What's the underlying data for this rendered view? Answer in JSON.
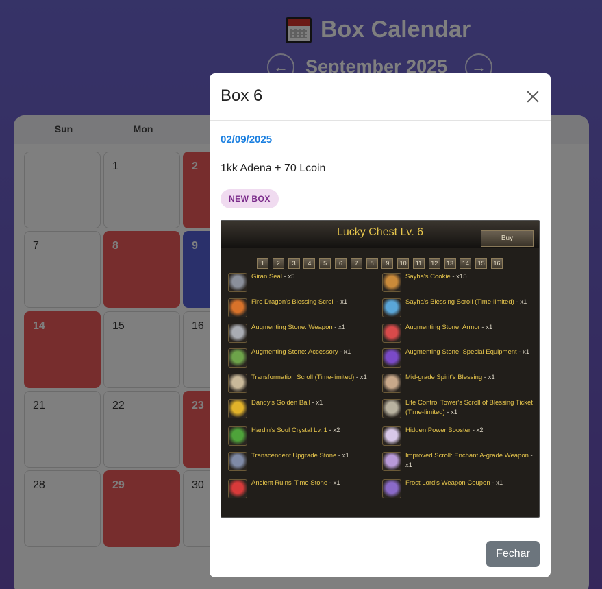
{
  "app": {
    "title": "Box Calendar",
    "month": "September 2025",
    "prev": "←",
    "next": "→"
  },
  "weekdays": [
    "Sun",
    "Mon"
  ],
  "days": [
    {
      "n": "",
      "style": "plain"
    },
    {
      "n": "1",
      "style": "plain"
    },
    {
      "n": "2",
      "style": "red"
    },
    {
      "n": "7",
      "style": "plain"
    },
    {
      "n": "8",
      "style": "red"
    },
    {
      "n": "9",
      "style": "blue"
    },
    {
      "n": "14",
      "style": "red"
    },
    {
      "n": "15",
      "style": "plain"
    },
    {
      "n": "16",
      "style": "plain"
    },
    {
      "n": "21",
      "style": "plain"
    },
    {
      "n": "22",
      "style": "plain"
    },
    {
      "n": "23",
      "style": "red"
    },
    {
      "n": "28",
      "style": "plain"
    },
    {
      "n": "29",
      "style": "red"
    },
    {
      "n": "30",
      "style": "plain"
    }
  ],
  "modal": {
    "title": "Box 6",
    "date": "02/09/2025",
    "description": "1kk Adena + 70 Lcoin",
    "badge": "NEW BOX",
    "close_button": "Fechar",
    "game": {
      "title": "Lucky Chest Lv. 6",
      "buy": "Buy",
      "pages": [
        "1",
        "2",
        "3",
        "4",
        "5",
        "6",
        "7",
        "8",
        "9",
        "10",
        "11",
        "12",
        "13",
        "14",
        "15",
        "16"
      ],
      "items_left": [
        {
          "name": "Giran Seal",
          "qty": " - x5",
          "color": "#8a8f9a"
        },
        {
          "name": "Fire Dragon's Blessing Scroll",
          "qty": " - x1",
          "color": "#d8722a"
        },
        {
          "name": "Augmenting Stone: Weapon",
          "qty": " - x1",
          "color": "#a9acb3"
        },
        {
          "name": "Augmenting Stone: Accessory",
          "qty": " - x1",
          "color": "#6da34a"
        },
        {
          "name": "Transformation Scroll (Time-limited)",
          "qty": " - x1",
          "color": "#c9b99a"
        },
        {
          "name": "Dandy's Golden Ball",
          "qty": " - x1",
          "color": "#e2b32a"
        },
        {
          "name": "Hardin's Soul Crystal Lv. 1",
          "qty": " - x2",
          "color": "#4ea33a"
        },
        {
          "name": "Transcendent Upgrade Stone",
          "qty": " - x1",
          "color": "#7f8aa6"
        },
        {
          "name": "Ancient Ruins' Time Stone",
          "qty": " - x1",
          "color": "#d83a3a"
        }
      ],
      "items_right": [
        {
          "name": "Sayha's Cookie",
          "qty": " - x15",
          "color": "#c98a3a"
        },
        {
          "name": "Sayha's Blessing Scroll (Time-limited)",
          "qty": " - x1",
          "color": "#5aa6d8"
        },
        {
          "name": "Augmenting Stone: Armor",
          "qty": " - x1",
          "color": "#d84a4a"
        },
        {
          "name": "Augmenting Stone: Special Equipment",
          "qty": " - x1",
          "color": "#7a4ac8"
        },
        {
          "name": "Mid-grade Spirit's Blessing",
          "qty": " - x1",
          "color": "#c8a88a"
        },
        {
          "name": "Life Control Tower's Scroll of Blessing Ticket (Time-limited)",
          "qty": " - x1",
          "color": "#b8b2a0"
        },
        {
          "name": "Hidden Power Booster",
          "qty": " - x2",
          "color": "#d8c8e8"
        },
        {
          "name": "Improved Scroll: Enchant A-grade Weapon",
          "qty": " - x1",
          "color": "#b89ad8"
        },
        {
          "name": "Frost Lord's Weapon Coupon",
          "qty": " - x1",
          "color": "#8a6ac8"
        }
      ]
    }
  }
}
